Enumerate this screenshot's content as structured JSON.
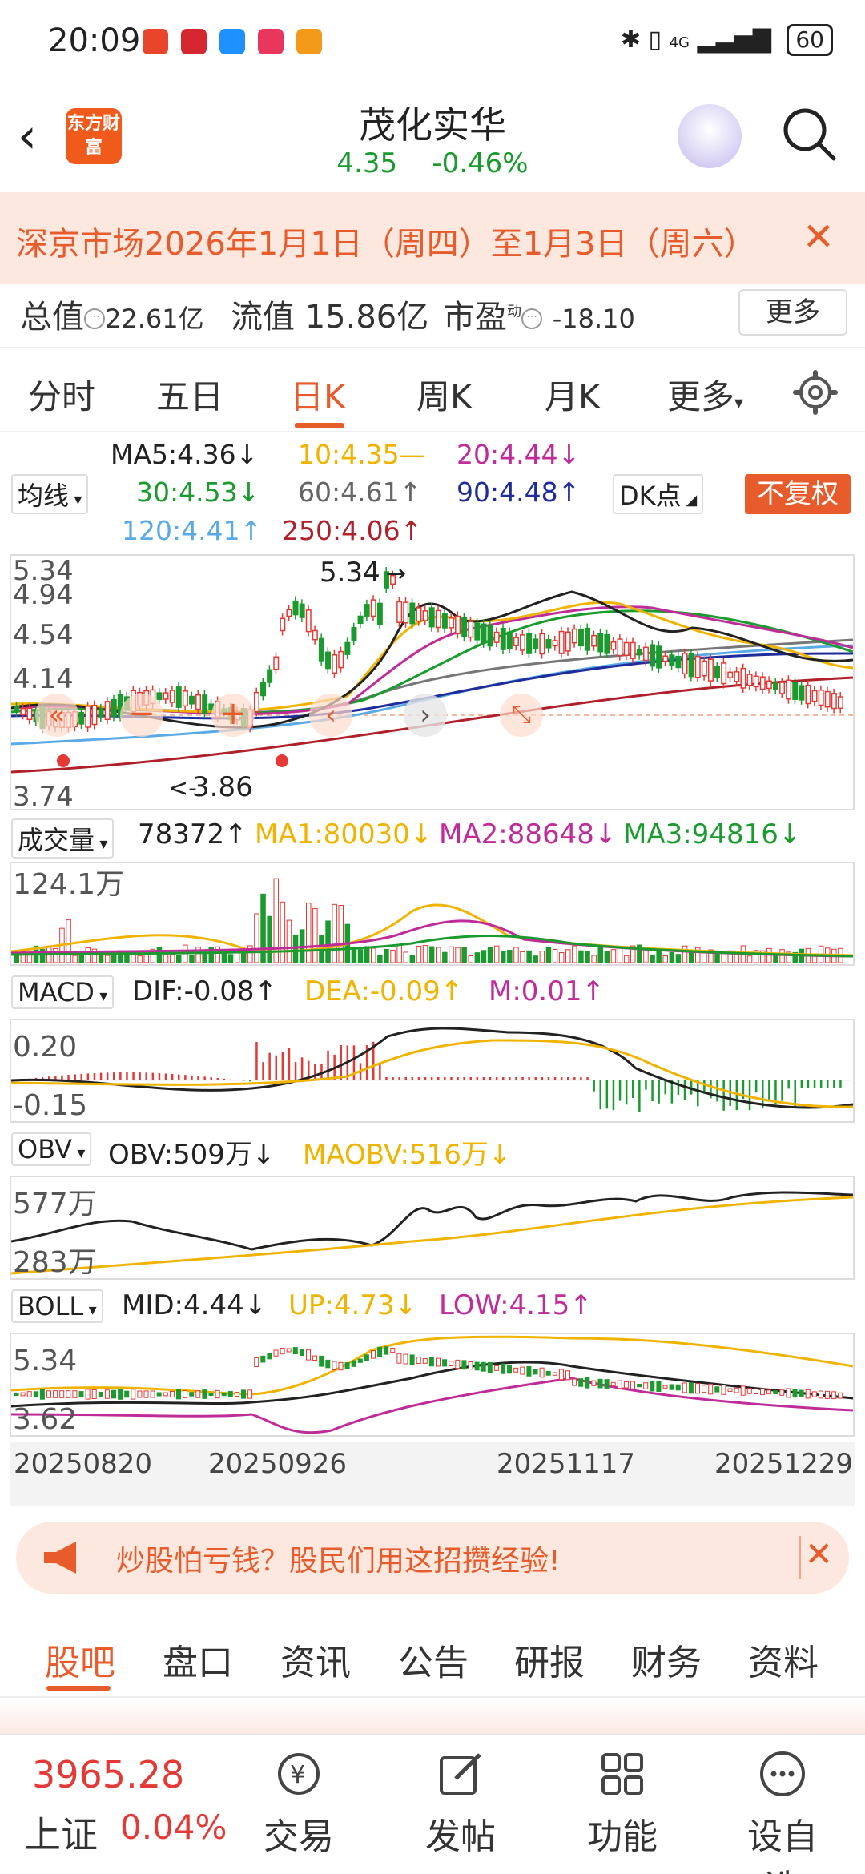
{
  "status": {
    "time": "20:09",
    "battery": "60",
    "network": "4G"
  },
  "header": {
    "name": "茂化实华",
    "price": "4.35",
    "change": "-0.46%",
    "logo": "东方财富"
  },
  "notice": {
    "text": "深京市场2026年1月1日（周四）至1月3日（周六）"
  },
  "metrics": {
    "total_label": "总值",
    "total": "22.61亿",
    "float_label": "流值",
    "float": "15.86亿",
    "pe_label": "市盈",
    "pe_sup": "动",
    "pe": "-18.10",
    "more": "更多"
  },
  "periods": [
    "分时",
    "五日",
    "日K",
    "周K",
    "月K",
    "更多"
  ],
  "ma_legend": {
    "selector": "均线",
    "ma5": "MA5:4.36↓",
    "ma10": "10:4.35—",
    "ma20": "20:4.44↓",
    "ma30": "30:4.53↓",
    "ma60": "60:4.61↑",
    "ma90": "90:4.48↑",
    "ma120": "120:4.41↑",
    "ma250": "250:4.06↑",
    "dk": "DK点",
    "fuquan": "不复权"
  },
  "kline": {
    "y_top": "5.34",
    "y_2": "4.94",
    "y_3": "4.54",
    "y_4": "4.14",
    "y_bottom": "3.74",
    "high_label": "5.34",
    "low_label": "3.86"
  },
  "volume": {
    "selector": "成交量",
    "vol": "78372↑",
    "ma1": "MA1:80030↓",
    "ma2": "MA2:88648↓",
    "ma3": "MA3:94816↓",
    "y_top": "124.1万"
  },
  "macd": {
    "selector": "MACD",
    "dif": "DIF:-0.08↑",
    "dea": "DEA:-0.09↑",
    "m": "M:0.01↑",
    "y_top": "0.20",
    "y_bottom": "-0.15"
  },
  "obv": {
    "selector": "OBV",
    "obv": "OBV:509万↓",
    "maobv": "MAOBV:516万↓",
    "y_top": "577万",
    "y_bottom": "283万"
  },
  "boll": {
    "selector": "BOLL",
    "mid": "MID:4.44↓",
    "up": "UP:4.73↓",
    "low": "LOW:4.15↑",
    "y_top": "5.34",
    "y_bottom": "3.62"
  },
  "dates": [
    "20250820",
    "20250926",
    "20251117",
    "20251229"
  ],
  "ad": {
    "text": "炒股怕亏钱？股民们用这招攒经验!"
  },
  "bottom_tabs": [
    "股吧",
    "盘口",
    "资讯",
    "公告",
    "研报",
    "财务",
    "资料"
  ],
  "footer": {
    "index_value": "3965.28",
    "index_name": "上证",
    "index_change": "0.04%",
    "trade": "交易",
    "post": "发帖",
    "func": "功能",
    "watch": "设自选"
  },
  "colors": {
    "accent": "#e85c2c",
    "up": "#e53935",
    "down": "#1a9b2e"
  }
}
